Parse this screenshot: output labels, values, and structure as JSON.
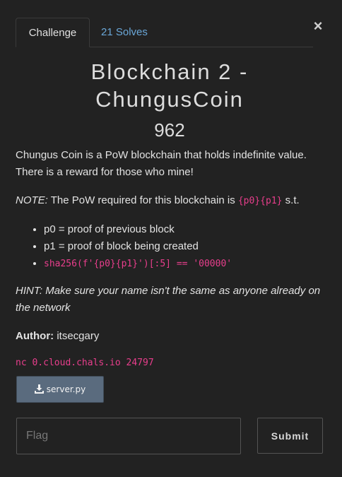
{
  "tabs": {
    "challenge": "Challenge",
    "solves": "21 Solves"
  },
  "close_glyph": "×",
  "challenge": {
    "title": "Blockchain 2 - ChungusCoin",
    "value": "962",
    "description": {
      "intro": "Chungus Coin is a PoW blockchain that holds indefinite value. There is a reward for those who mine!",
      "note_label": "NOTE:",
      "note_text": " The PoW required for this blockchain is ",
      "note_code": "{p0}{p1}",
      "note_suffix": " s.t.",
      "bullets": [
        "p0 = proof of previous block",
        "p1 = proof of block being created"
      ],
      "bullet_code": "sha256(f'{p0}{p1}')[:5] == '00000'",
      "hint": "HINT: Make sure your name isn't the same as anyone already on the network",
      "author_label": "Author:",
      "author_name": " itsecgary",
      "connection": "nc 0.cloud.chals.io 24797"
    },
    "file": {
      "icon": "download-icon",
      "name": "server.py"
    }
  },
  "form": {
    "flag_placeholder": "Flag",
    "flag_value": "",
    "submit_label": "Submit"
  },
  "colors": {
    "background": "#222222",
    "link": "#6aa7d8",
    "code": "#e83e8c",
    "file_button": "#5a6b7e"
  }
}
